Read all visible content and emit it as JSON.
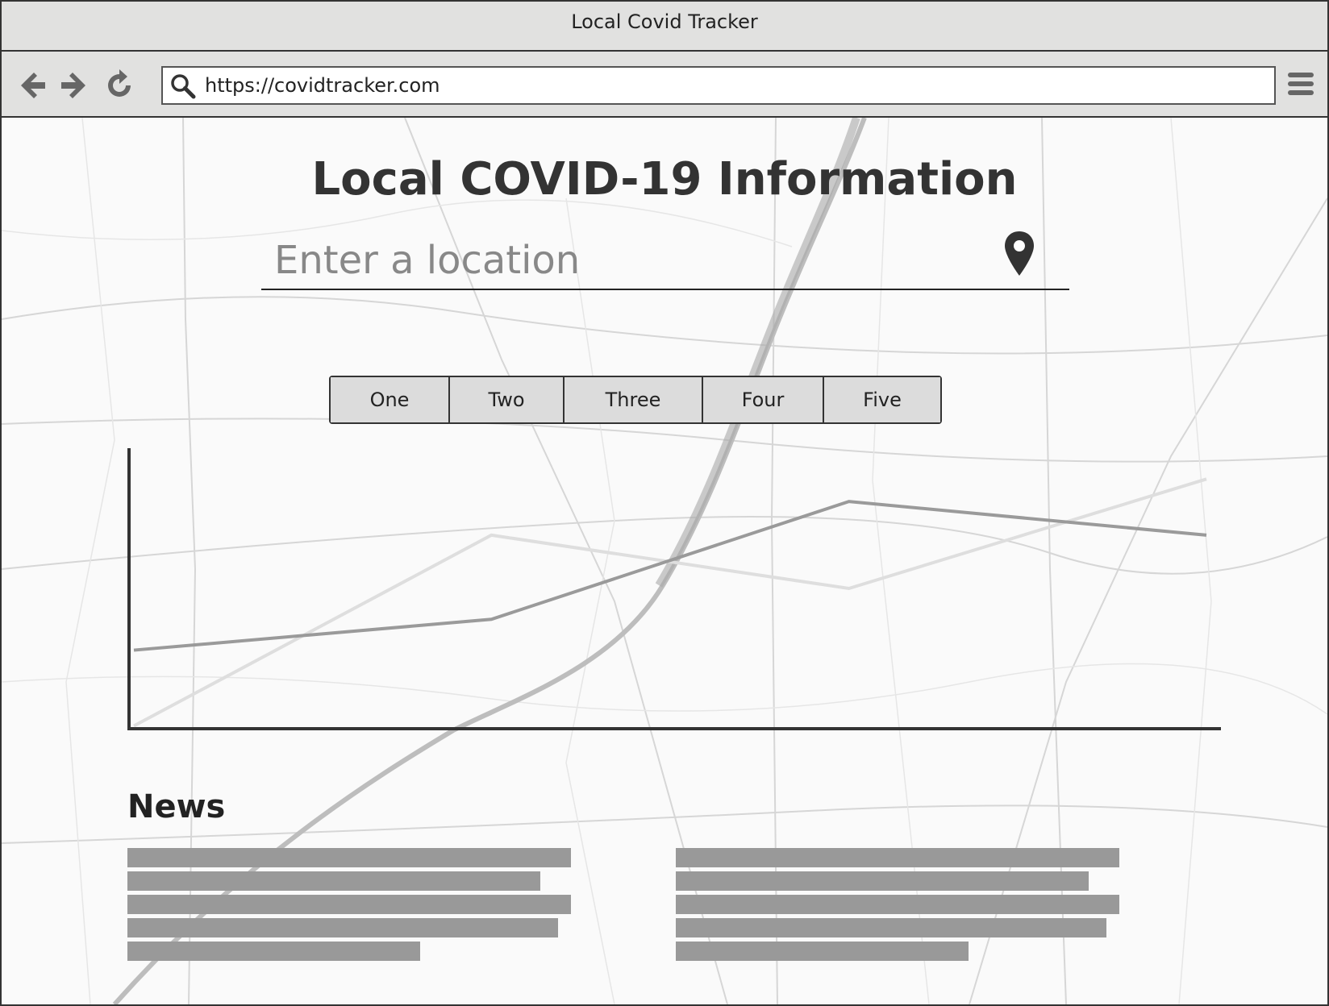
{
  "window": {
    "title": "Local Covid Tracker"
  },
  "toolbar": {
    "back_icon": "arrow-left-icon",
    "forward_icon": "arrow-right-icon",
    "reload_icon": "reload-icon",
    "menu_icon": "hamburger-menu-icon"
  },
  "address_bar": {
    "url": "https://covidtracker.com",
    "icon": "search-icon"
  },
  "main": {
    "title": "Local COVID-19 Information",
    "location_placeholder": "Enter a location",
    "location_icon": "map-pin-icon",
    "tabs": [
      {
        "label": "One"
      },
      {
        "label": "Two"
      },
      {
        "label": "Three"
      },
      {
        "label": "Four"
      },
      {
        "label": "Five"
      }
    ]
  },
  "chart_data": {
    "type": "line",
    "title": "",
    "xlabel": "",
    "ylabel": "",
    "x": [
      0,
      1,
      2,
      3
    ],
    "series": [
      {
        "values": [
          2.8,
          3.9,
          8.1,
          6.9
        ],
        "color": "#9a9a9a"
      },
      {
        "values": [
          0.1,
          6.9,
          5.0,
          8.9
        ],
        "color": "#dedede"
      }
    ],
    "ylim": [
      0,
      10
    ],
    "grid": false
  },
  "news": {
    "heading": "News",
    "columns": [
      {
        "lines": [
          1.0,
          0.93,
          1.0,
          0.97,
          0.66
        ]
      },
      {
        "lines": [
          1.0,
          0.93,
          1.0,
          0.97,
          0.66
        ]
      }
    ]
  },
  "colors": {
    "chrome": "#e1e1e0",
    "border": "#333333",
    "placeholder_bar": "#999999"
  }
}
